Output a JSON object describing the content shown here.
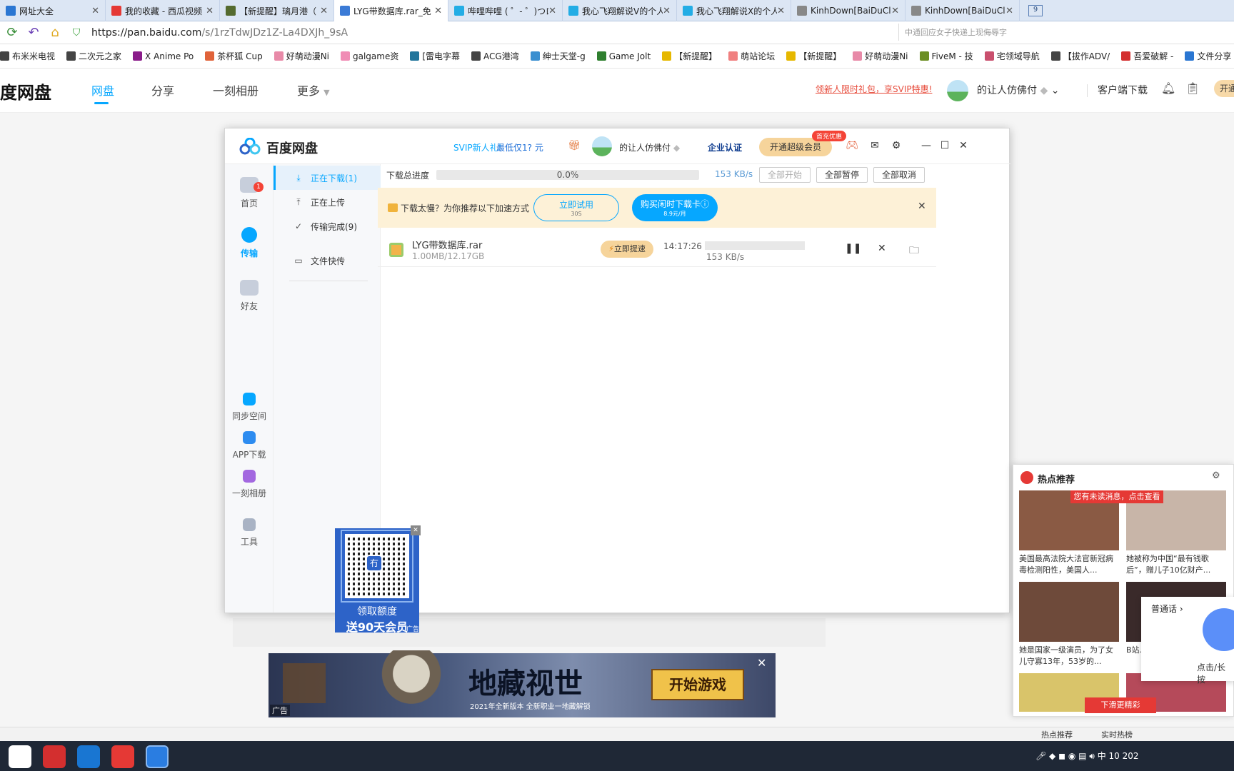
{
  "tabs": [
    {
      "title": "网址大全",
      "color": "#2a76d2",
      "active": false
    },
    {
      "title": "我的收藏 - 西瓜视频",
      "color": "#e53935",
      "active": false
    },
    {
      "title": "【新提醒】璃月港（",
      "color": "#556b2f",
      "active": false
    },
    {
      "title": "LYG带数据库.rar_免",
      "color": "#3b7bd6",
      "active": true
    },
    {
      "title": "哔哩哔哩 ( ゜- ゜)つロ",
      "color": "#23ade5",
      "active": false
    },
    {
      "title": "我心飞翔解说V的个人",
      "color": "#23ade5",
      "active": false
    },
    {
      "title": "我心飞翔解说X的个人",
      "color": "#23ade5",
      "active": false
    },
    {
      "title": "KinhDown[BaiDuClo",
      "color": "#888888",
      "active": false
    },
    {
      "title": "KinhDown[BaiDuClo",
      "color": "#888888",
      "active": false
    }
  ],
  "tab_count": "9",
  "address": {
    "host": "https://pan.baidu.com",
    "path": "/s/1rzTdwJDz1Z-La4DXJh_9sA",
    "search_placeholder": "中通回应女子快递上现侮辱字"
  },
  "bookmarks": [
    {
      "label": "布米米电视",
      "color": "#444"
    },
    {
      "label": "二次元之家",
      "color": "#444"
    },
    {
      "label": "X Anime Po",
      "color": "#8a1c8a"
    },
    {
      "label": "茶杯狐 Cup",
      "color": "#e0633a"
    },
    {
      "label": "好萌动漫Ni",
      "color": "#e88aa8"
    },
    {
      "label": "galgame资",
      "color": "#f08cb5"
    },
    {
      "label": "[雷电字幕",
      "color": "#21759b"
    },
    {
      "label": "ACG港湾",
      "color": "#444"
    },
    {
      "label": "绅士天堂-g",
      "color": "#3a8fd0"
    },
    {
      "label": "Game Jolt",
      "color": "#2f7f2f"
    },
    {
      "label": "【新提醒】",
      "color": "#e6b800"
    },
    {
      "label": "萌站论坛",
      "color": "#f08080"
    },
    {
      "label": "【新提醒】",
      "color": "#e6b800"
    },
    {
      "label": "好萌动漫Ni",
      "color": "#e88aa8"
    },
    {
      "label": "FiveM - 技",
      "color": "#6b8e23"
    },
    {
      "label": "宅领域导航",
      "color": "#c94f6d"
    },
    {
      "label": "【拔作ADV/",
      "color": "#444"
    },
    {
      "label": "吾爱破解 -",
      "color": "#d32f2f"
    },
    {
      "label": "文件分享",
      "color": "#2a76d2"
    }
  ],
  "page_header": {
    "brand": "度网盘",
    "nav": [
      "网盘",
      "分享",
      "一刻相册",
      "更多"
    ],
    "promo": "领新人限时礼包，享SVIP特惠!",
    "user": "的让人仿佛付",
    "client": "客户端下载",
    "open_btn": "开通"
  },
  "client": {
    "logo": "百度网盘",
    "svip_label": "SVIP新人礼!",
    "svip_price": "最低仅1? 元",
    "user": "的让人仿佛付",
    "enterprise": "企业认证",
    "vip_btn": "开通超级会员",
    "first_badge": "首充优惠",
    "side": [
      {
        "label": "首页"
      },
      {
        "label": "传输",
        "badge": "1"
      },
      {
        "label": "好友"
      },
      {
        "label": "同步空间"
      },
      {
        "label": "APP下载"
      },
      {
        "label": "一刻相册"
      },
      {
        "label": "工具"
      }
    ],
    "subnav": [
      {
        "label": "正在下载(1)",
        "icon": "⤓"
      },
      {
        "label": "正在上传",
        "icon": "⤒"
      },
      {
        "label": "传输完成(9)",
        "icon": "✓"
      },
      {
        "label": "文件快传",
        "icon": "▭"
      }
    ],
    "ad": {
      "line1": "领取额度",
      "line2": "送90天会员",
      "tag": "广告",
      "qr_label": "冇"
    },
    "progress": {
      "label": "下载总进度",
      "percent": "0.0%",
      "value": 0.0,
      "speed": "153 KB/s"
    },
    "buttons": {
      "start": "全部开始",
      "pause": "全部暂停",
      "cancel": "全部取消"
    },
    "tip": {
      "text": "下载太慢？为你推荐以下加速方式",
      "try": "立即试用",
      "try_sub": "30S",
      "buy": "购买闲时下载卡ⓘ",
      "buy_sub": "8.9元/月"
    },
    "file": {
      "name": "LYG带数据库.rar",
      "size": "1.00MB/12.17GB",
      "speedup": "立即提速",
      "time": "14:17:26",
      "speed": "153 KB/s"
    }
  },
  "hot": {
    "title": "热点推荐",
    "unread": "您有未读消息，点击查看",
    "slide": "下滑更精彩",
    "cards": [
      {
        "caption": "美国最高法院大法官新冠病毒检测阳性，美国人...",
        "color": "#8a5a44"
      },
      {
        "caption": "她被称为中国“最有钱歌后”，赠儿子10亿财产...",
        "color": "#c8b5a8"
      },
      {
        "caption": "她是国家一级演员，为了女儿守寡13年，53岁的...",
        "color": "#6e4a3a"
      },
      {
        "caption": "B站...二",
        "color": "#3a2a2a"
      },
      {
        "caption": "",
        "color": "#d9c46a"
      },
      {
        "caption": "",
        "color": "#b54a5a"
      }
    ]
  },
  "voice": {
    "title": "普通话",
    "sub": "点击/长按"
  },
  "banner": {
    "title": "地藏视世",
    "sub": "2021年全新版本 全新职业一地藏解锁",
    "btn": "开始游戏",
    "tag": "广告"
  },
  "strip": {
    "hot": "热点推荐",
    "rt": "实时热榜"
  },
  "tray": {
    "ime": "中",
    "time": "10",
    "date": "202"
  }
}
